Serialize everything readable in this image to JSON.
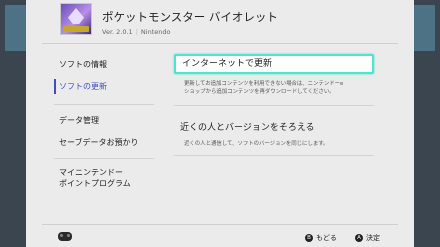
{
  "header": {
    "title": "ポケットモンスター バイオレット",
    "version": "Ver. 2.0.1",
    "publisher": "Nintendo"
  },
  "sidebar": {
    "items": [
      {
        "label": "ソフトの情報",
        "active": false
      },
      {
        "label": "ソフトの更新",
        "active": true
      },
      {
        "label": "データ管理",
        "active": false
      },
      {
        "label": "セーブデータお預かり",
        "active": false
      },
      {
        "label_lines": [
          "マイニンテンドー",
          "ポイントプログラム"
        ],
        "active": false
      }
    ]
  },
  "content": {
    "options": [
      {
        "label": "インターネットで更新",
        "selected": true,
        "description_lines": [
          "更新してお追加コンテンツを利用できない場合は、ニンテンドーe",
          "ショップから追加コンテンツを再ダウンロードしてください。"
        ]
      },
      {
        "label": "近くの人とバージョンをそろえる",
        "selected": false,
        "description_lines": [
          "近くの人と通信して、ソフトのバージョンを同じにします。"
        ]
      }
    ]
  },
  "footer": {
    "back_button": "B",
    "back_label": "もどる",
    "ok_button": "A",
    "ok_label": "決定"
  },
  "colors": {
    "accent": "#3c4ec8",
    "selection": "#4fe3d0",
    "panel": "#ebebeb"
  }
}
